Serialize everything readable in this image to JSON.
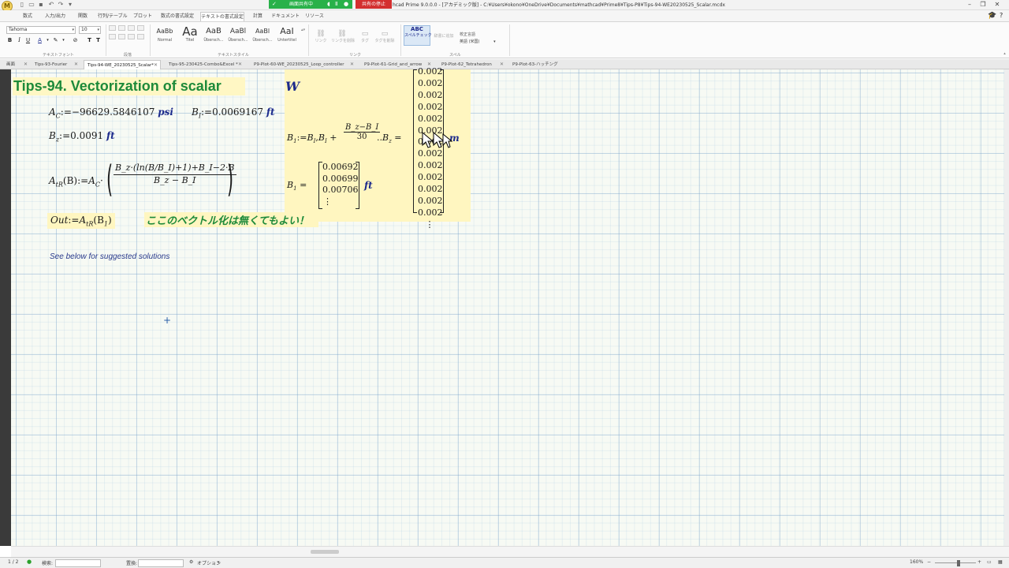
{
  "titlebar": {
    "share_label": "画面共有中",
    "stop_share_label": "共有の停止",
    "window_title": "hcad Prime 9.0.0.0 - [アカデミック版] - C:¥Users¥okono¥OneDrive¥Documents¥mathcad¥Prime8¥Tips-P8¥Tips-94-WE20230525_Scalar.mcdx",
    "logo": "M"
  },
  "ribbon_tabs": [
    "数式",
    "入力/出力",
    "関数",
    "行列/テーブル",
    "プロット",
    "数式の書式設定",
    "テキストの書式設定",
    "計算",
    "ドキュメント",
    "リソース"
  ],
  "ribbon": {
    "font_name": "Tahoma",
    "font_size": "10",
    "group_labels": {
      "text_font": "テキストフォント",
      "paragraph": "段落",
      "text_style": "テキストスタイル",
      "link": "リンク",
      "spell": "スペル"
    },
    "styles": [
      {
        "preview": "AaBb",
        "name": "Normal"
      },
      {
        "preview": "Aa",
        "name": "Titel"
      },
      {
        "preview": "AaB",
        "name": "Übersch..."
      },
      {
        "preview": "AaBl",
        "name": "Übersch..."
      },
      {
        "preview": "AaBl",
        "name": "Übersch..."
      },
      {
        "preview": "AaI",
        "name": "Untertitel"
      }
    ],
    "link_buttons": [
      "リンク",
      "リンクを削除",
      "タグ",
      "タグを削除"
    ],
    "spellcheck_label": "スペルチェック",
    "spellcheck_icon": "ABC",
    "proofing_language_label": "校正言語",
    "proofing_language_value": "英語 (米国)",
    "dictionary_label": "辞書に追加"
  },
  "doc_tabs": [
    {
      "label": "画面"
    },
    {
      "label": "Tips-93-Fourier"
    },
    {
      "label": "Tips-94-WE_20230525_Scalar*",
      "active": true
    },
    {
      "label": "Tips-95-230425-Combo&Excel *"
    },
    {
      "label": "P9-Plot-60-WE_20230525_Loop_controller"
    },
    {
      "label": "P9-Plot-61-Grid_and_arrow"
    },
    {
      "label": "P9-Plot-62_Tetrahedron"
    },
    {
      "label": "P9-Plot-63-ハッチング"
    }
  ],
  "worksheet": {
    "title": "Tips-94. Vectorization of scalar",
    "title_overflow": "W",
    "ac_def": {
      "lhs": "A",
      "sub": "C",
      "op": ":=",
      "value": "−96629.5846107",
      "unit": "psi"
    },
    "bi_def": {
      "lhs": "B",
      "sub": "I",
      "op": ":=",
      "value": "0.0069167",
      "unit": "ft"
    },
    "bz_def": {
      "lhs": "B",
      "sub": "z",
      "op": ":=",
      "value": "0.0091",
      "unit": "ft"
    },
    "atr_def": {
      "lhs": "A",
      "sub": "tR",
      "arg": "(B)",
      "op": ":=",
      "rhs_prefix": "A",
      "rhs_prefix_sub": "C",
      "numerator": "B_z·(ln(B/B_I)+1)+B_I−2·B",
      "denominator": "B_z − B_I"
    },
    "out_def": {
      "lhs": "Out",
      "op": ":=",
      "rhs": "A",
      "rhs_sub": "tR",
      "arg": "(B",
      "arg_sub": "1",
      "arg_close": ")"
    },
    "comment_jp": "ここのベクトル化は無くてもよい！",
    "note": "See below for suggested solutions",
    "b1_range": {
      "lhs": "B",
      "sub": "1",
      "op": ":=",
      "start": "B",
      "start_sub": "I",
      "second": "B",
      "second_sub": "I",
      "step_num": "B_z−B_I",
      "step_den": "30",
      "range_op": "..",
      "end": "B",
      "end_sub": "z",
      "eq": "="
    },
    "range_column": [
      "0.002",
      "0.002",
      "0.002",
      "0.002",
      "0.002",
      "0.002",
      "0.002",
      "0.002",
      "0.002",
      "0.002",
      "0.002",
      "0.002",
      "0.002",
      "⋮"
    ],
    "range_unit": "m",
    "b1_eval": {
      "lhs": "B",
      "sub": "1",
      "eq": "=",
      "values": [
        "0.00692",
        "0.00699",
        "0.00706",
        "⋮"
      ],
      "unit": "ft"
    }
  },
  "statusbar": {
    "page": "1 / 2",
    "search_label": "検索:",
    "replace_label": "置換:",
    "options_label": "オプション",
    "zoom": "160%"
  },
  "colors": {
    "accent_green": "#1d8a3a",
    "unit_blue": "#1c2a8c",
    "highlight": "#fff6c0",
    "share_green": "#29b14a",
    "stop_red": "#d32f2f"
  }
}
